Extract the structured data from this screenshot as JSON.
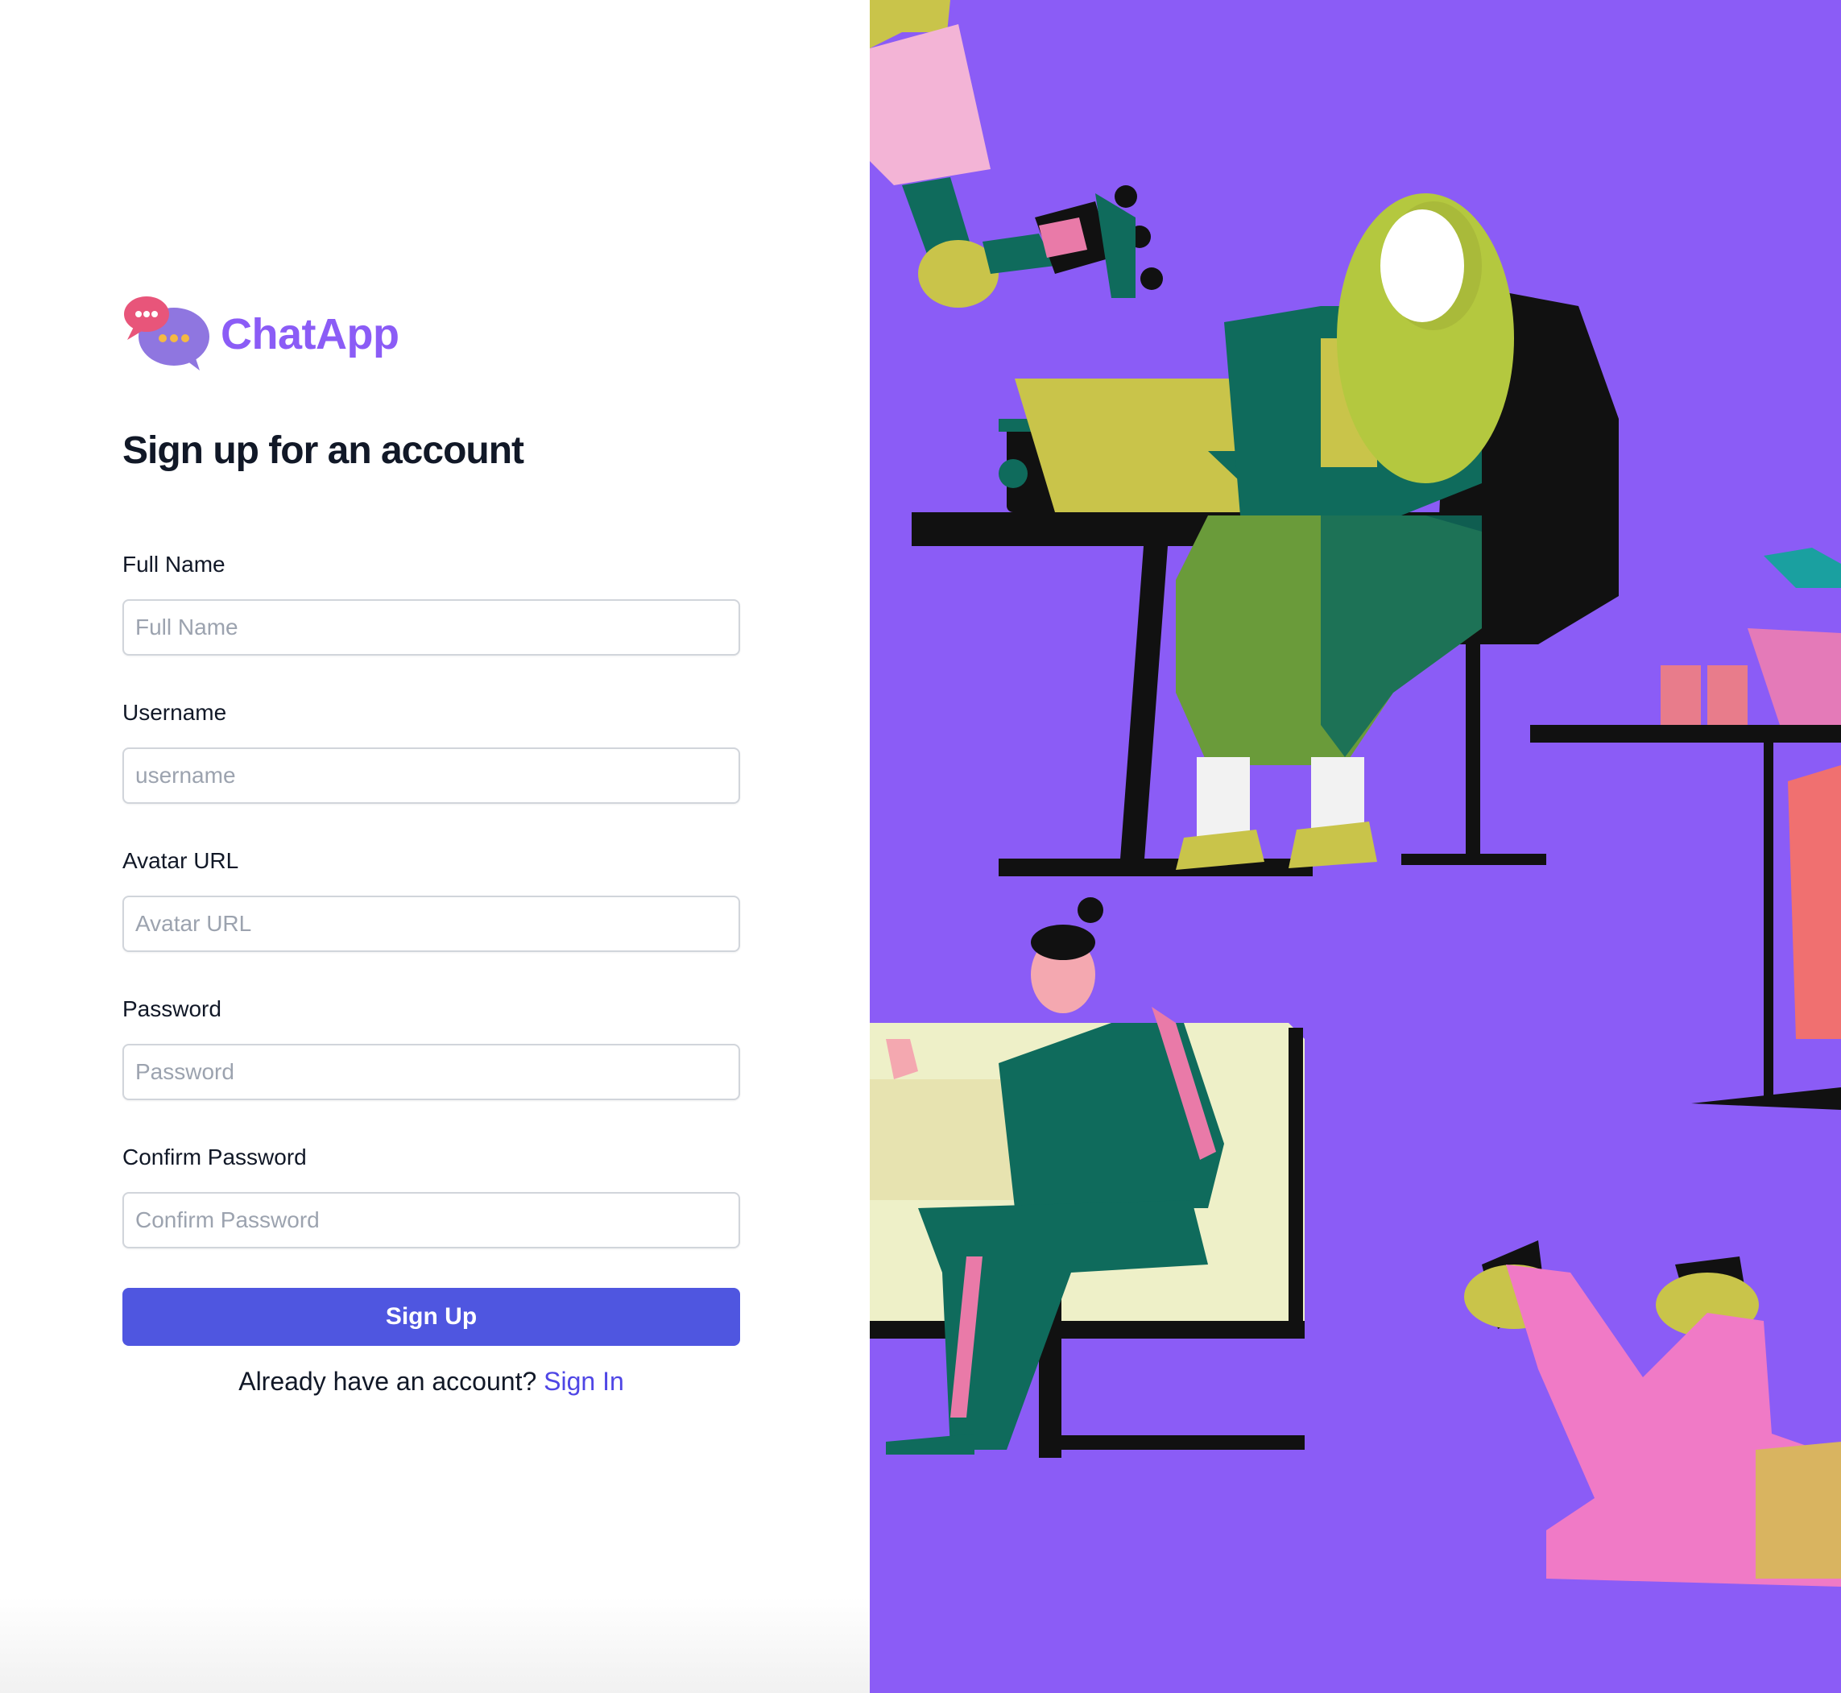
{
  "brand": {
    "name": "ChatApp",
    "logo_icon": "chat-bubbles-icon"
  },
  "form": {
    "heading": "Sign up for an account",
    "fields": [
      {
        "label": "Full Name",
        "placeholder": "Full Name",
        "value": ""
      },
      {
        "label": "Username",
        "placeholder": "username",
        "value": ""
      },
      {
        "label": "Avatar URL",
        "placeholder": "Avatar URL",
        "value": ""
      },
      {
        "label": "Password",
        "placeholder": "Password",
        "value": ""
      },
      {
        "label": "Confirm Password",
        "placeholder": "Confirm Password",
        "value": ""
      }
    ],
    "submit_label": "Sign Up",
    "signin_prompt": "Already have an account?",
    "signin_link": "Sign In"
  },
  "colors": {
    "brand": "#8b5cf6",
    "primary_button": "#4f56e0",
    "link": "#4f46e5",
    "illustration_background": "#8b5cf6"
  }
}
